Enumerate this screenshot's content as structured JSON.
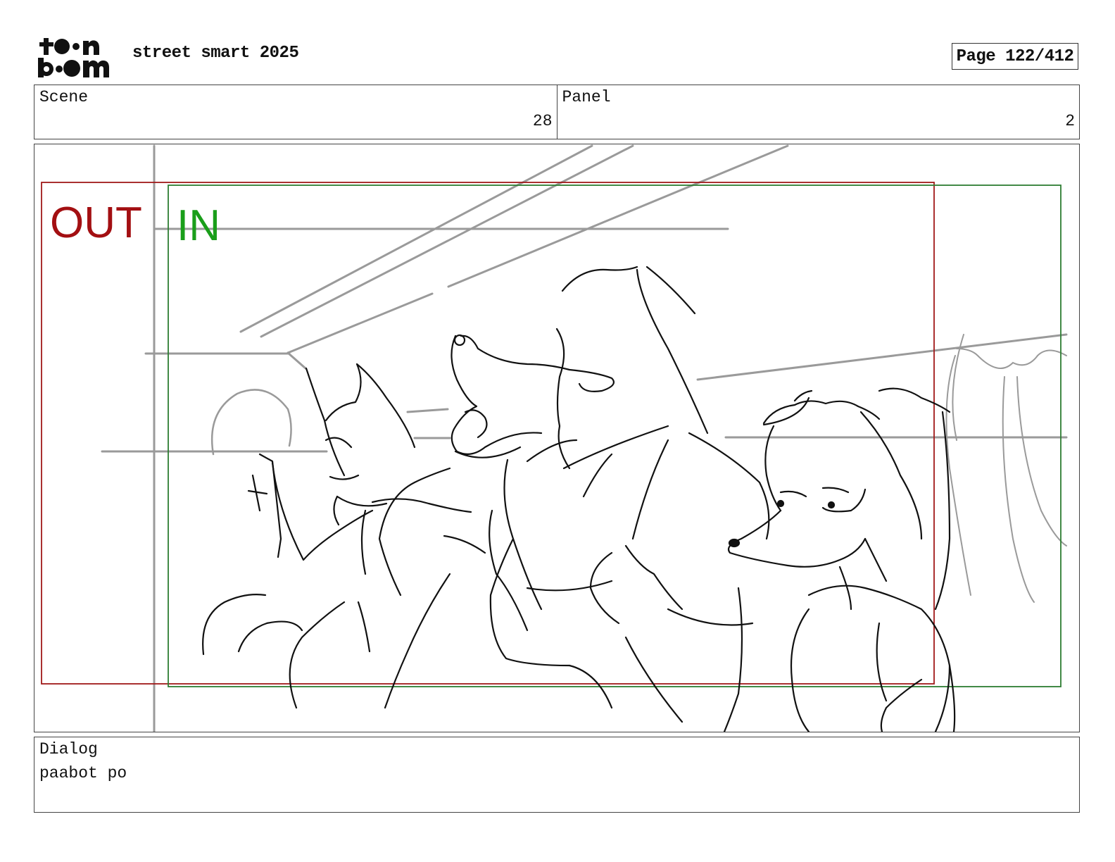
{
  "header": {
    "logo_text": "toon boom",
    "project_title": "street smart 2025",
    "page_indicator": "Page 122/412"
  },
  "info": {
    "scene_label": "Scene",
    "scene_value": "28",
    "panel_label": "Panel",
    "panel_value": "2"
  },
  "panel": {
    "out_label": "OUT",
    "in_label": "IN",
    "colors": {
      "out_frame": "#a01a1a",
      "in_frame": "#2e7d32",
      "out_text": "#a30f12",
      "in_text": "#1a9e1a",
      "guide_lines": "#999999",
      "sketch": "#111111"
    }
  },
  "dialog": {
    "label": "Dialog",
    "text": "paabot po"
  }
}
